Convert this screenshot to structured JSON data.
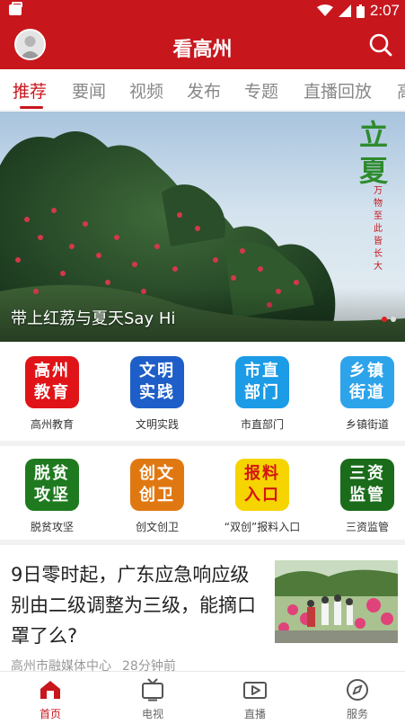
{
  "statusbar": {
    "time": "2:07"
  },
  "appbar": {
    "title": "看高州"
  },
  "tabs": [
    "推荐",
    "要闻",
    "视频",
    "发布",
    "专题",
    "直播回放",
    "高"
  ],
  "banner": {
    "caption": "带上红荔与夏天Say Hi",
    "overlay_title": "立夏",
    "overlay_sub": "万物至此皆长大"
  },
  "grid_row1": [
    {
      "tile": "高州\n教育",
      "label": "高州教育",
      "color": "#e01418"
    },
    {
      "tile": "文明\n实践",
      "label": "文明实践",
      "color": "#1e5ec8"
    },
    {
      "tile": "市直\n部门",
      "label": "市直部门",
      "color": "#1c9be6"
    },
    {
      "tile": "乡镇\n街道",
      "label": "乡镇街道",
      "color": "#2da3ea"
    }
  ],
  "grid_row2": [
    {
      "tile": "脱贫\n攻坚",
      "label": "脱贫攻坚",
      "color": "#1f7a1f"
    },
    {
      "tile": "创文\n创卫",
      "label": "创文创卫",
      "color": "#e07812"
    },
    {
      "tile": "报料\n入口",
      "label": "“双创”报料入口",
      "color": "#f5d400"
    },
    {
      "tile": "三资\n监管",
      "label": "三资监管",
      "color": "#1a6b1a"
    }
  ],
  "news": {
    "title": "9日零时起，广东应急响应级别由二级调整为三级，能摘口罩了么?",
    "source": "高州市融媒体中心",
    "time": "28分钟前"
  },
  "bottomnav": [
    {
      "label": "首页",
      "icon": "home-icon"
    },
    {
      "label": "电视",
      "icon": "tv-icon"
    },
    {
      "label": "直播",
      "icon": "live-video-icon"
    },
    {
      "label": "服务",
      "icon": "compass-icon"
    }
  ]
}
